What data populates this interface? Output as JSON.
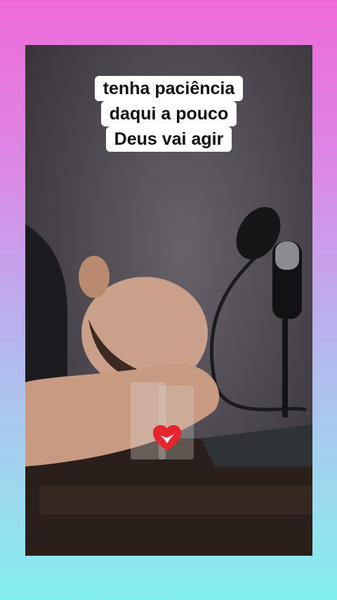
{
  "caption": {
    "lines": [
      "tenha paciência",
      "daqui a pouco",
      "Deus vai agir"
    ]
  },
  "colors": {
    "frame_top": "#ef6ad9",
    "frame_bottom": "#84f0ee",
    "caption_bg": "#ffffff",
    "heart": "#e7252f"
  },
  "icons": [
    "heart-dove-logo-icon",
    "microphone-icon"
  ]
}
